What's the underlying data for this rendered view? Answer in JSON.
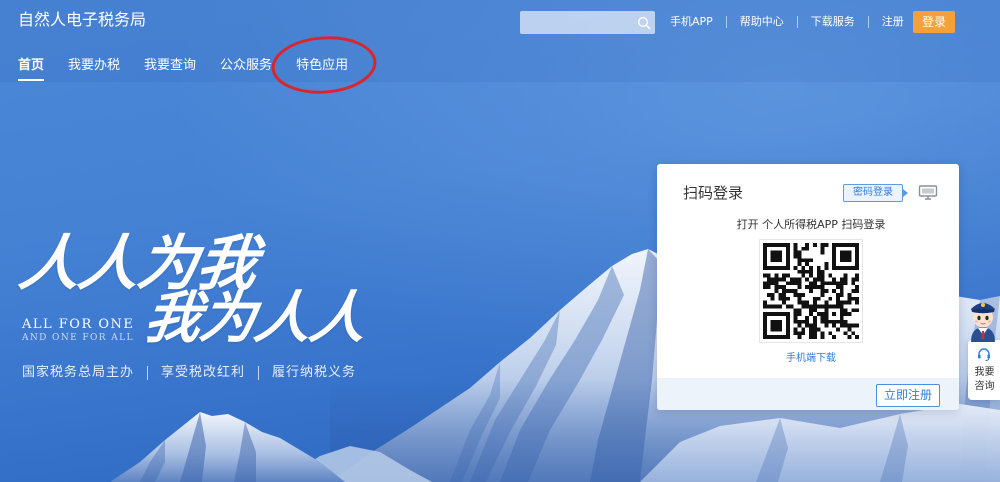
{
  "colors": {
    "accent": "#f5a13a",
    "primary": "#2f7fd6",
    "annotation": "#d9262d"
  },
  "header": {
    "title": "自然人电子税务局",
    "search_icon": "search-icon",
    "links": [
      "手机APP",
      "帮助中心",
      "下载服务",
      "注册"
    ],
    "login_label": "登录"
  },
  "nav": {
    "items": [
      {
        "label": "首页",
        "active": true
      },
      {
        "label": "我要办税",
        "active": false
      },
      {
        "label": "我要查询",
        "active": false
      },
      {
        "label": "公众服务",
        "active": false
      },
      {
        "label": "特色应用",
        "active": false,
        "highlighted": true
      }
    ]
  },
  "hero": {
    "slogan_line1": "人人为我",
    "slogan_line2": "我为人人",
    "english_line1": "ALL FOR ONE",
    "english_line2": "AND ONE FOR ALL",
    "taglines": [
      "国家税务总局主办",
      "享受税改红利",
      "履行纳税义务"
    ]
  },
  "login_card": {
    "title": "扫码登录",
    "password_login_label": "密码登录",
    "switch_icon": "monitor-icon",
    "instruction": "打开 个人所得税APP 扫码登录",
    "qr_icon": "qr-code",
    "download_link": "手机端下载",
    "register_label": "立即注册"
  },
  "consult_widget": {
    "avatar_icon": "tax-officer-avatar-icon",
    "headset_icon": "headset-icon",
    "label": "我要咨询"
  }
}
